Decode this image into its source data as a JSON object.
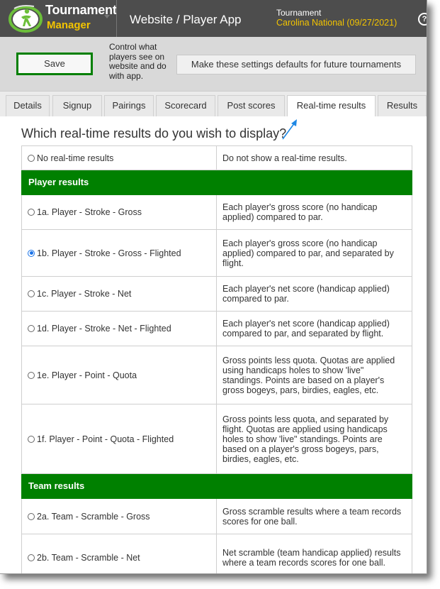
{
  "header": {
    "brand_line1": "Tournament",
    "brand_line2": "Manager",
    "app_title": "Website / Player App",
    "tournament_label": "Tournament",
    "tournament_name": "Carolina National (09/27/2021)",
    "colors": {
      "bar": "#4d4d4d",
      "accent": "#f3c400"
    }
  },
  "toolbar": {
    "save_label": "Save",
    "control_text": "Control what players see on website and do with app.",
    "defaults_label": "Make these settings defaults for future tournaments"
  },
  "tabs": [
    {
      "label": "Details",
      "active": false
    },
    {
      "label": "Signup",
      "active": false
    },
    {
      "label": "Pairings",
      "active": false
    },
    {
      "label": "Scorecard",
      "active": false
    },
    {
      "label": "Post scores",
      "active": false
    },
    {
      "label": "Real-time results",
      "active": true
    },
    {
      "label": "Results",
      "active": false
    }
  ],
  "main": {
    "question": "Which real-time results do you wish to display?",
    "rows": [
      {
        "type": "option",
        "label": "No real-time results",
        "description": "Do not show a real-time results.",
        "selected": false,
        "height": 34
      },
      {
        "type": "section",
        "label": "Player results"
      },
      {
        "type": "option",
        "label": "1a. Player - Stroke - Gross",
        "description": "Each player's gross score (no handicap applied) compared to par.",
        "selected": false,
        "height": 49
      },
      {
        "type": "option",
        "label": "1b. Player - Stroke - Gross - Flighted",
        "description": "Each player's gross score (no handicap applied) compared to par, and separated by flight.",
        "selected": true,
        "height": 66
      },
      {
        "type": "option",
        "label": "1c. Player - Stroke - Net",
        "description": "Each player's net score (handicap applied) compared to par.",
        "selected": false,
        "height": 49
      },
      {
        "type": "option",
        "label": "1d. Player - Stroke - Net - Flighted",
        "description": "Each player's net score (handicap applied) compared to par, and separated by flight.",
        "selected": false,
        "height": 49
      },
      {
        "type": "option",
        "label": "1e. Player - Point - Quota",
        "description": "Gross points less quota. Quotas are applied using handicaps holes to show 'live\" standings. Points are based on a player's gross bogeys, pars, birdies, eagles, etc.",
        "selected": false,
        "height": 82
      },
      {
        "type": "option",
        "label": "1f. Player - Point - Quota - Flighted",
        "description": "Gross points less quota, and separated by flight. Quotas are applied using handicaps holes to show 'live\" standings. Points are based on a player's gross bogeys, pars, birdies, eagles, etc.",
        "selected": false,
        "height": 98
      },
      {
        "type": "section",
        "label": "Team results"
      },
      {
        "type": "option",
        "label": "2a. Team - Scramble - Gross",
        "description": "Gross scramble results where a team records scores for one ball.",
        "selected": false,
        "height": 50
      },
      {
        "type": "option",
        "label": "2b. Team - Scramble - Net",
        "description": "Net scramble (team handicap applied) results where a team records scores for one ball.",
        "selected": false,
        "height": 66
      }
    ]
  },
  "colors": {
    "section_green": "#008000",
    "save_border": "#007f00",
    "radio_selected": "#1a73e8"
  }
}
